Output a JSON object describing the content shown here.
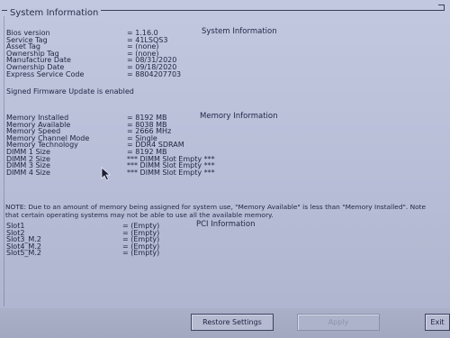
{
  "window": {
    "title": "System Information"
  },
  "system": {
    "heading": "System Information",
    "items": [
      {
        "label": "Bios version",
        "value": "= 1.16.0"
      },
      {
        "label": "Service Tag",
        "value": "= 41LSQS3"
      },
      {
        "label": "Asset Tag",
        "value": "= (none)"
      },
      {
        "label": "Ownership Tag",
        "value": "= (none)"
      },
      {
        "label": "Manufacture Date",
        "value": "= 08/31/2020"
      },
      {
        "label": "Ownership Date",
        "value": "= 09/18/2020"
      },
      {
        "label": "Express Service Code",
        "value": "= 8804207703"
      }
    ],
    "firmware_message": "Signed Firmware Update is enabled"
  },
  "memory": {
    "heading": "Memory Information",
    "items": [
      {
        "label": "Memory Installed",
        "value": "= 8192 MB"
      },
      {
        "label": "Memory Available",
        "value": "= 8038 MB"
      },
      {
        "label": "Memory Speed",
        "value": "= 2666 MHz"
      },
      {
        "label": "Memory Channel Mode",
        "value": "= Single"
      },
      {
        "label": "Memory Technology",
        "value": "= DDR4 SDRAM"
      },
      {
        "label": "DIMM 1 Size",
        "value": "= 8192 MB"
      },
      {
        "label": "DIMM 2 Size",
        "value": "*** DIMM Slot Empty ***"
      },
      {
        "label": "DIMM 3 Size",
        "value": "*** DIMM Slot Empty ***"
      },
      {
        "label": "DIMM 4 Size",
        "value": "*** DIMM Slot Empty ***"
      }
    ],
    "note": "NOTE: Due to an amount of memory being assigned for system use, \"Memory Available\" is less than \"Memory Installed\". Note that certain operating systems may not be able to use all the available memory."
  },
  "pci": {
    "heading": "PCI Information",
    "items": [
      {
        "label": "Slot1",
        "value": "= (Empty)"
      },
      {
        "label": "Slot2",
        "value": "= (Empty)"
      },
      {
        "label": "Slot3_M.2",
        "value": "= (Empty)"
      },
      {
        "label": "Slot4_M.2",
        "value": "= (Empty)"
      },
      {
        "label": "Slot5_M.2",
        "value": "= (Empty)"
      }
    ]
  },
  "buttons": {
    "restore": "Restore Settings",
    "apply": "Apply",
    "exit": "Exit"
  }
}
